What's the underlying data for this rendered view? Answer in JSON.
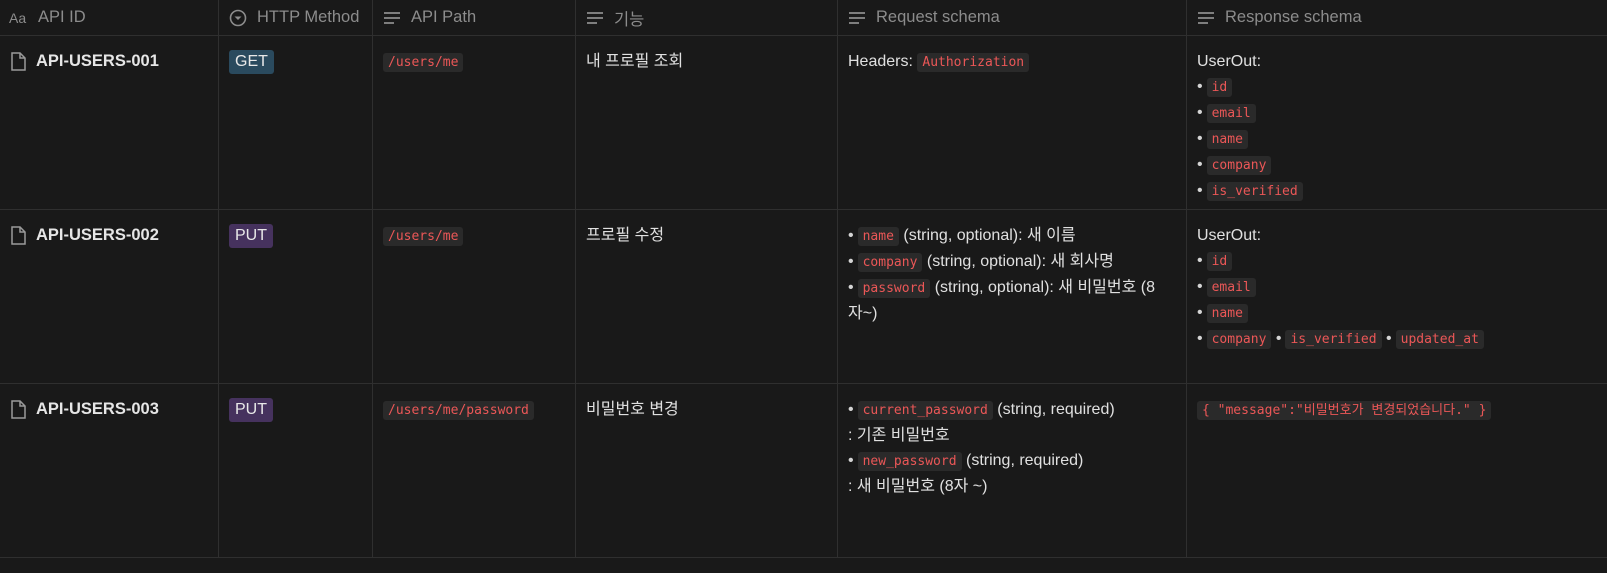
{
  "columns": [
    {
      "label": "API ID",
      "icon": "title-icon"
    },
    {
      "label": "HTTP Method",
      "icon": "select-icon"
    },
    {
      "label": "API Path",
      "icon": "text-icon"
    },
    {
      "label": "기능",
      "icon": "text-icon"
    },
    {
      "label": "Request schema",
      "icon": "text-icon"
    },
    {
      "label": "Response schema",
      "icon": "text-icon"
    }
  ],
  "rows": [
    {
      "id": "API-USERS-001",
      "method": "GET",
      "path": "/users/me",
      "feature": "내 프로필 조회",
      "request": {
        "prefix": "Headers:",
        "code": "Authorization"
      },
      "response": {
        "title": "UserOut:",
        "items": [
          "id",
          "email",
          "name",
          "company",
          "is_verified"
        ]
      }
    },
    {
      "id": "API-USERS-002",
      "method": "PUT",
      "path": "/users/me",
      "feature": "프로필 수정",
      "request": {
        "items": [
          {
            "code": "name",
            "text": "(string, optional): 새 이름"
          },
          {
            "code": "company",
            "text": "(string, optional): 새 회사명"
          },
          {
            "code": "password",
            "text": "(string, optional): 새 비밀번호 (8",
            "cont": "자~)"
          }
        ]
      },
      "response": {
        "title": "UserOut:",
        "items": [
          "id",
          "email",
          "name"
        ],
        "last_line": [
          "company",
          "is_verified",
          "updated_at"
        ]
      }
    },
    {
      "id": "API-USERS-003",
      "method": "PUT",
      "path": "/users/me/password",
      "feature": "비밀번호 변경",
      "request": {
        "items": [
          {
            "code": "current_password",
            "text": "(string, required)",
            "cont": ": 기존 비밀번호"
          },
          {
            "code": "new_password",
            "text": "(string, required)",
            "cont": ": 새 비밀번호 (8자 ~)"
          }
        ]
      },
      "response": {
        "code": "{ \"message\":\"비밀번호가 변경되었습니다.\" }"
      }
    }
  ]
}
